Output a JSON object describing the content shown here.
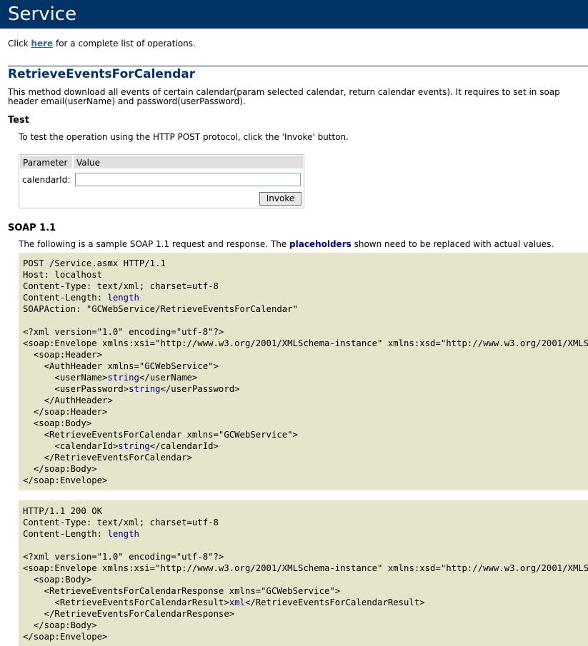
{
  "header": {
    "title": "Service"
  },
  "intro": {
    "prefix": "Click ",
    "link": "here",
    "suffix": " for a complete list of operations."
  },
  "operation": {
    "name": "RetrieveEventsForCalendar",
    "description": "This method download all events of certain calendar(param selected calendar, return calendar events). It requires to set in soap header email(userName) and password(userPassword)."
  },
  "test": {
    "heading": "Test",
    "instructions": "To test the operation using the HTTP POST protocol, click the 'Invoke' button.",
    "form": {
      "col_parameter": "Parameter",
      "col_value": "Value",
      "param_label": "calendarId:",
      "param_value": "",
      "invoke_label": "Invoke"
    }
  },
  "soap": {
    "heading": "SOAP 1.1",
    "intro_pre": "The following is a sample SOAP 1.1 request and response. The ",
    "intro_bold": "placeholders",
    "intro_post": " shown need to be replaced with actual values.",
    "request": [
      [
        "POST /Service.asmx HTTP/1.1",
        ""
      ],
      [
        "Host: localhost",
        ""
      ],
      [
        "Content-Type: text/xml; charset=utf-8",
        ""
      ],
      [
        "Content-Length: ",
        "length"
      ],
      [
        "SOAPAction: \"GCWebService/RetrieveEventsForCalendar\"",
        ""
      ],
      [
        "",
        ""
      ],
      [
        "<?xml version=\"1.0\" encoding=\"utf-8\"?>",
        ""
      ],
      [
        "<soap:Envelope xmlns:xsi=\"http://www.w3.org/2001/XMLSchema-instance\" xmlns:xsd=\"http://www.w3.org/2001/XMLSchema\" xmlns:soap=\"http://schemas.xmlsoap.org/soap/envelope/\">",
        ""
      ],
      [
        "  <soap:Header>",
        ""
      ],
      [
        "    <AuthHeader xmlns=\"GCWebService\">",
        ""
      ],
      [
        "      <userName>",
        "string",
        "</userName>"
      ],
      [
        "      <userPassword>",
        "string",
        "</userPassword>"
      ],
      [
        "    </AuthHeader>",
        ""
      ],
      [
        "  </soap:Header>",
        ""
      ],
      [
        "  <soap:Body>",
        ""
      ],
      [
        "    <RetrieveEventsForCalendar xmlns=\"GCWebService\">",
        ""
      ],
      [
        "      <calendarId>",
        "string",
        "</calendarId>"
      ],
      [
        "    </RetrieveEventsForCalendar>",
        ""
      ],
      [
        "  </soap:Body>",
        ""
      ],
      [
        "</soap:Envelope>",
        ""
      ]
    ],
    "response": [
      [
        "HTTP/1.1 200 OK",
        ""
      ],
      [
        "Content-Type: text/xml; charset=utf-8",
        ""
      ],
      [
        "Content-Length: ",
        "length"
      ],
      [
        "",
        ""
      ],
      [
        "<?xml version=\"1.0\" encoding=\"utf-8\"?>",
        ""
      ],
      [
        "<soap:Envelope xmlns:xsi=\"http://www.w3.org/2001/XMLSchema-instance\" xmlns:xsd=\"http://www.w3.org/2001/XMLSchema\" xmlns:soap=\"http://schemas.xmlsoap.org/soap/envelope/\">",
        ""
      ],
      [
        "  <soap:Body>",
        ""
      ],
      [
        "    <RetrieveEventsForCalendarResponse xmlns=\"GCWebService\">",
        ""
      ],
      [
        "      <RetrieveEventsForCalendarResult>",
        "xml",
        "</RetrieveEventsForCalendarResult>"
      ],
      [
        "    </RetrieveEventsForCalendarResponse>",
        ""
      ],
      [
        "  </soap:Body>",
        ""
      ],
      [
        "</soap:Envelope>",
        ""
      ]
    ]
  },
  "colors": {
    "header_bg": "#003366",
    "title_text": "#003366",
    "link": "#336699",
    "code_bg": "#e5e5cc",
    "placeholder_value": "#000080"
  }
}
